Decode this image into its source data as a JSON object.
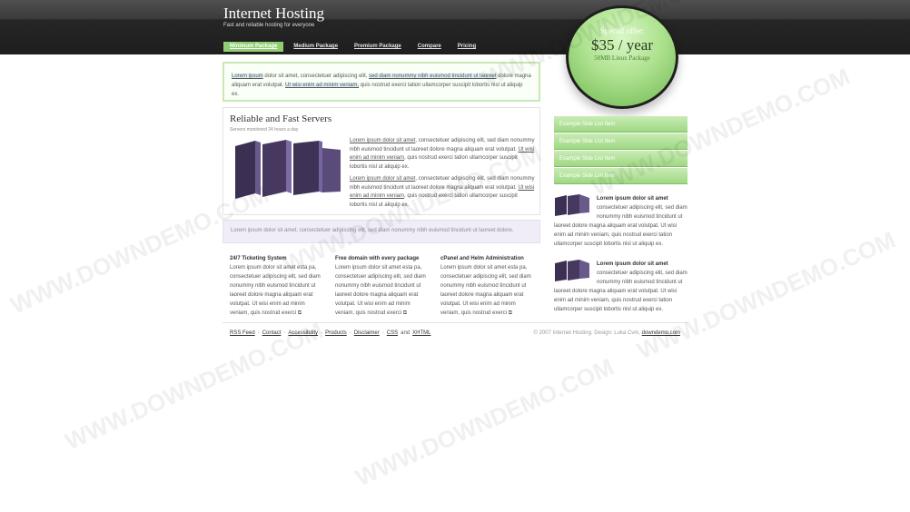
{
  "header": {
    "title": "Internet Hosting",
    "tagline": "Fast and reliable hosting for everyone"
  },
  "nav": {
    "items": [
      "Minimum Package",
      "Medium Package",
      "Premium Package",
      "Compare",
      "Pricing"
    ],
    "active_index": 0
  },
  "offer": {
    "label": "Special offer:",
    "price": "$35 / year",
    "desc": "50MB Linux Package"
  },
  "intro": {
    "s1": "Lorem ipsum",
    "s2": " dolor sit amet, consectetuer adipiscing elit, ",
    "s3": "sed diam nonummy nibh euismod tincidunt ut laoreet",
    "s4": " dolore magna aliquam erat volutpat. ",
    "s5": "Ut wisi enim ad minim veniam,",
    "s6": " quis nostrud exerci tation ullamcorper suscipit lobortis nisl ut aliquip ex."
  },
  "servers": {
    "title": "Reliable and Fast Servers",
    "subtitle": "Servers monitored 24 hours a day",
    "p1_link": "Lorem ipsum dolor sit amet",
    "p1_text": ", consectetuer adipiscing elit, sed diam nonummy nibh euismod tincidunt ut laoreet dolore magna aliquam erat volutpat. ",
    "p1_link2": "Ut wisi enim ad minim veniam",
    "p1_text2": ", quis nostrud exerci tation ullamcorper suscipit lobortis nisl ut aliquip ex.",
    "p2_link": "Lorem ipsum dolor sit amet",
    "p2_text": ", consectetuer adipiscing elit, sed diam nonummy nibh euismod tincidunt ut laoreet dolore magna aliquam erat volutpat. ",
    "p2_link2": "Ut wisi enim ad minim veniam",
    "p2_text2": ", quis nostrud exerci tation ullamcorper suscipit lobortis nisl ut aliquip ex."
  },
  "notice": {
    "text": "Lorem ipsum dolor sit amet, consectetuer adipiscing elit, sed diam nonummy nibh euismod tincidunt ut laoreet dolore."
  },
  "features": [
    {
      "title": "24/7 Ticketing System",
      "text": "Lorem ipsum dolor sit amet esta pa, consectetuer adipiscing elit, sed diam nonummy nibh euismod tincidunt ut laoreet dolore magna aliquam erat volutpat. Ut wisi enim ad minim veniam, quis nostrud exerci"
    },
    {
      "title": "Free domain with every package",
      "text": "Lorem ipsum dolor sit amet esta pa, consectetuer adipiscing elit, sed diam nonummy nibh euismod tincidunt ut laoreet dolore magna aliquam erat volutpat. Ut wisi enim ad minim veniam, quis nostrud exerci"
    },
    {
      "title": "cPanel and Helm Administration",
      "text": "Lorem ipsum dolor sit amet esta pa, consectetuer adipiscing elit, sed diam nonummy nibh euismod tincidunt ut laoreet dolore magna aliquam erat volutpat. Ut wisi enim ad minim veniam, quis nostrud exerci"
    }
  ],
  "sidebar": {
    "list": [
      "Example Side List Item",
      "Example Side List Item",
      "Example Side List Item",
      "Example Side List Item"
    ],
    "blocks": [
      {
        "title": "Lorem ipsum dolor sit amet",
        "text_a": "consectetuer adipiscing elit, sed diam nonummy nibh euismod tincidunt ut",
        "text_b": "laoreet dolore magna aliquam erat volutpat. Ut wisi enim ad minim veniam, quis nostrud exerci tation ullamcorper suscipit lobortis nisl ut aliquip ex."
      },
      {
        "title": "Lorem ipsum dolor sit amet",
        "text_a": "consectetuer adipiscing elit, sed diam nonummy nibh euismod tincidunt ut",
        "text_b": "laoreet dolore magna aliquam erat volutpat. Ut wisi enim ad minim veniam, quis nostrud exerci tation ullamcorper suscipit lobortis nisl ut aliquip ex."
      }
    ]
  },
  "footer": {
    "links": [
      "RSS Feed",
      "Contact",
      "Accessibility",
      "Products",
      "Disclaimer",
      "CSS",
      "XHTML"
    ],
    "and": "and",
    "copy": "© 2007 Internet Hosting. Design: Luka Cvrk,",
    "copy_link": "downdemo.com"
  },
  "watermark": {
    "text": "WWW.DOWNDEMO.COM"
  },
  "colors": {
    "accent_green": "#8fce72",
    "header_dark": "#262626",
    "server_purple": "#4a3c66"
  }
}
